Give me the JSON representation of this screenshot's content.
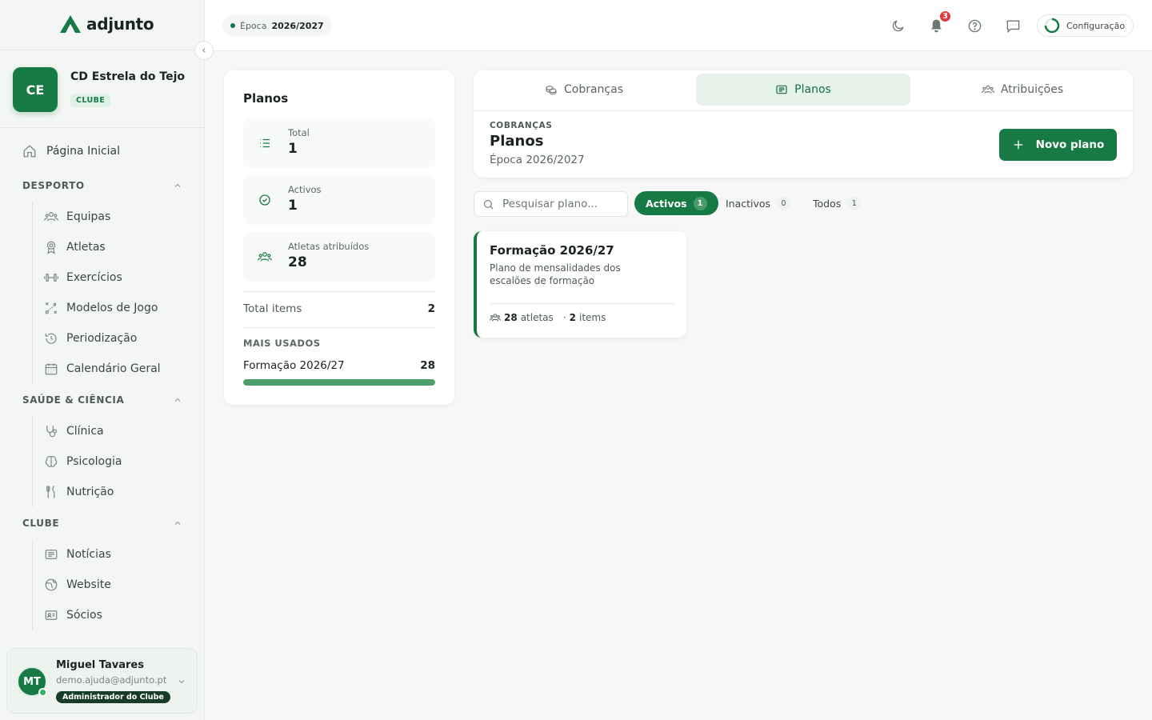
{
  "brand": {
    "name": "adjunto"
  },
  "club": {
    "initials": "CE",
    "name": "CD Estrela do Tejo",
    "badge": "CLUBE"
  },
  "nav": {
    "home": "Página Inicial",
    "sections": [
      {
        "title": "DESPORTO",
        "items": [
          "Equipas",
          "Atletas",
          "Exercícios",
          "Modelos de Jogo",
          "Periodização",
          "Calendário Geral"
        ]
      },
      {
        "title": "SAÚDE & CIÊNCIA",
        "items": [
          "Clínica",
          "Psicologia",
          "Nutrição"
        ]
      },
      {
        "title": "CLUBE",
        "items": [
          "Notícias",
          "Website",
          "Sócios"
        ]
      }
    ]
  },
  "user": {
    "initials": "MT",
    "name": "Miguel Tavares",
    "email": "demo.ajuda@adjunto.pt",
    "role": "Administrador do Clube"
  },
  "topbar": {
    "season_label": "Época",
    "season_value": "2026/2027",
    "notifications": "3",
    "config_label": "Configuração"
  },
  "stats": {
    "title": "Planos",
    "cards": [
      {
        "label": "Total",
        "value": "1"
      },
      {
        "label": "Activos",
        "value": "1"
      },
      {
        "label": "Atletas atribuídos",
        "value": "28"
      }
    ],
    "total_items_label": "Total items",
    "total_items_value": "2",
    "most_used_title": "MAIS USADOS",
    "most_used": {
      "name": "Formação 2026/27",
      "value": "28",
      "fraction": 1.0
    }
  },
  "tabs": [
    {
      "label": "Cobranças",
      "active": false
    },
    {
      "label": "Planos",
      "active": true
    },
    {
      "label": "Atribuições",
      "active": false
    }
  ],
  "panel": {
    "kicker": "COBRANÇAS",
    "title": "Planos",
    "subtitle": "Época 2026/2027",
    "new_button": "Novo plano"
  },
  "filters": {
    "search_placeholder": "Pesquisar plano...",
    "options": [
      {
        "label": "Activos",
        "count": "1",
        "active": true
      },
      {
        "label": "Inactivos",
        "count": "0",
        "active": false
      },
      {
        "label": "Todos",
        "count": "1",
        "active": false
      }
    ]
  },
  "plans": [
    {
      "title": "Formação 2026/27",
      "description": "Plano de mensalidades dos escalões de formação",
      "athletes": "28",
      "athletes_label": "atletas",
      "items": "2",
      "items_label": "items"
    }
  ],
  "colors": {
    "brand": "#177a45",
    "accent_light": "#e6f3ea",
    "badge_red": "#e0393e"
  }
}
